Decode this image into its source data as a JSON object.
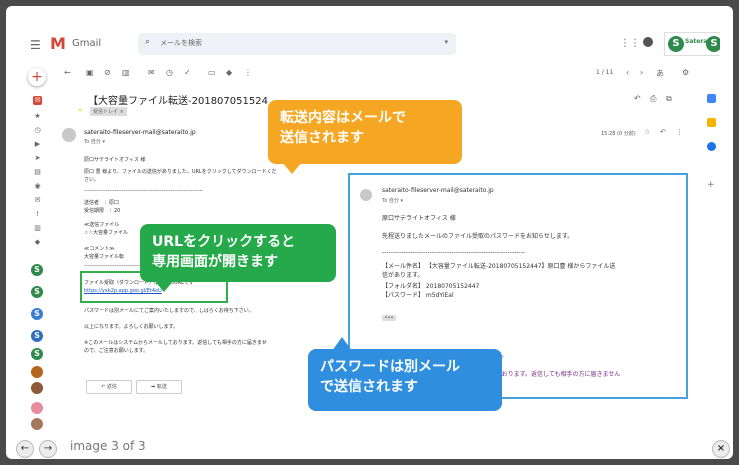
{
  "header": {
    "app_name": "Gmail",
    "logo_letter": "M",
    "search_placeholder": "メールを検索",
    "brand_letter": "S",
    "brand_text": "Sateraito"
  },
  "toolbar": {
    "pager": "1 / 11",
    "lang": "あ"
  },
  "email": {
    "subject": "【大容量ファイル転送-201807051524",
    "inbox_tag": "受信トレイ ×",
    "sender": "sateraito-fileserver-mail@sateraito.jp",
    "to": "To 自分 ▾",
    "time": "15:28 (0 分前)",
    "body_lines": [
      "原口サテライトオフィス 様",
      "原口 豊 様より、ファイルの送信がありました。URLをクリックしてダウンロードくだ",
      "さい。",
      "------------------------------------------------------------------",
      "送信者　：原口",
      "受信期限　：20",
      "≪送信ファイル",
      "☆☆大容量ファイル",
      "≪コメント≫",
      "大容量ファイル転",
      "------------------------------------------------------------------",
      "パスワードは別メールにてご案内いたしますので、しばらくお待ち下さい。",
      "以上になります。よろしくお願いします。",
      "※このメールはシステムからメールしております。返信しても相手の方に届きませ",
      "ので、ご注意お願いします。"
    ],
    "url_label": "ファイル受取（ダウンロード）は下記のURLです",
    "url": "https://yxk2p.app.goo.gl/Et4oU",
    "reply_button": "返信",
    "forward_button": "転送"
  },
  "mail2": {
    "sender": "sateraito-fileserver-mail@sateraito.jp",
    "to": "To 自分 ▾",
    "lines": [
      "原口サテライトオフィス 様",
      "先程送りましたメールのファイル受取のパスワードをお知らせします。",
      "------------------------------------------------------------------",
      "【メール件名】 【大容量ファイル転送-20180705152447】原口豊 様からファイル送",
      "信があります。",
      "【フォルダ名】 20180705152447",
      "【パスワード】 m5dYiEal"
    ],
    "tail_line_1": "ます。",
    "tail_line_2": "しております。返信しても相手の方に届きません",
    "dots": "•••"
  },
  "callouts": {
    "orange_1": "転送内容はメールで",
    "orange_2": "送信されます",
    "green_1": "URLをクリックすると",
    "green_2": "専用画面が開きます",
    "blue_1": "パスワードは別メール",
    "blue_2": "で送信されます"
  },
  "lightbox": {
    "caption": "image 3 of 3",
    "prev": "←",
    "next": "→",
    "close": "×"
  },
  "colors": {
    "gmail_red": "#d44638",
    "callout_orange": "#f5a623",
    "callout_green": "#25a94a",
    "callout_blue": "#2f8fde",
    "link_blue": "#1a57c4",
    "brand_green": "#2e8a4a"
  }
}
